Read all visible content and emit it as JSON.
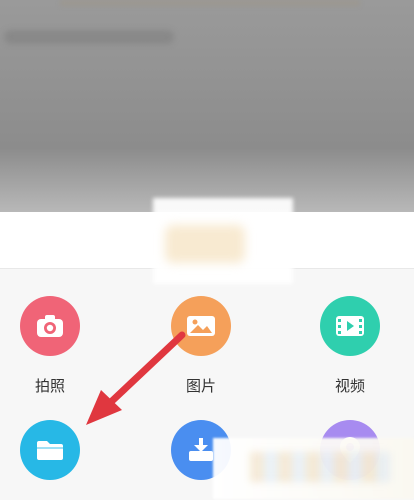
{
  "share_sheet": {
    "items": [
      {
        "label": "拍照",
        "icon": "camera-icon",
        "color": "#f06477"
      },
      {
        "label": "图片",
        "icon": "picture-icon",
        "color": "#f5a05a"
      },
      {
        "label": "视频",
        "icon": "video-icon",
        "color": "#2fcfae"
      },
      {
        "label": "",
        "icon": "folder-icon",
        "color": "#27b8e6"
      },
      {
        "label": "",
        "icon": "download-icon",
        "color": "#4a8ef0"
      },
      {
        "label": "",
        "icon": "location-icon",
        "color": "#a78bf0"
      }
    ]
  },
  "annotation": {
    "arrow_color": "#e0373f"
  }
}
